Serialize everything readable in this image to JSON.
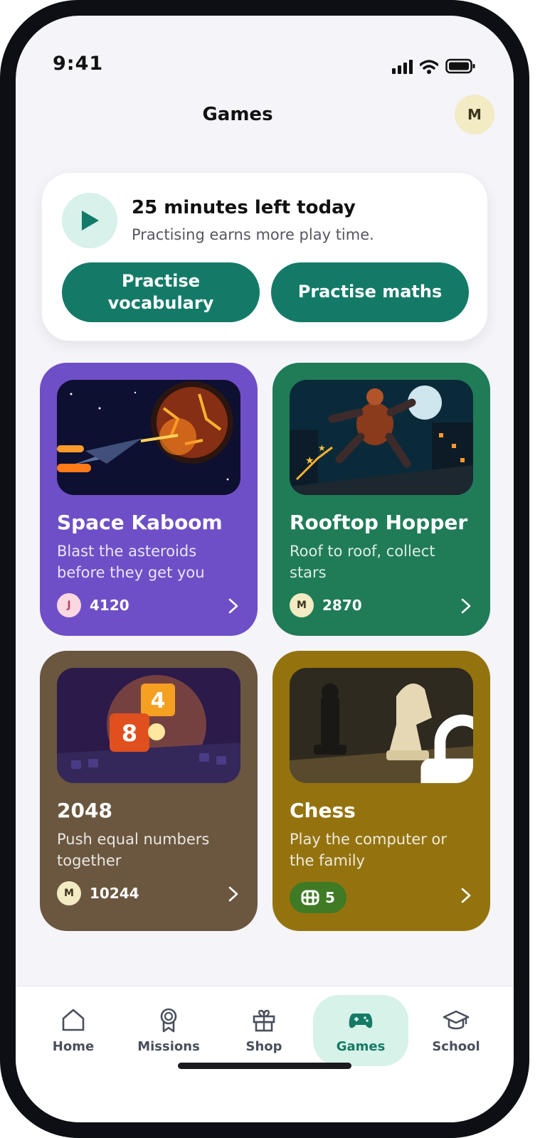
{
  "status_bar": {
    "time": "9:41"
  },
  "header": {
    "title": "Games",
    "avatar_initial": "M"
  },
  "playtime": {
    "title": "25 minutes left today",
    "subtitle": "Practising earns more play time.",
    "buttons": [
      {
        "label": "Practise vocabulary"
      },
      {
        "label": "Practise maths"
      }
    ]
  },
  "games": [
    {
      "title": "Space Kaboom",
      "description": "Blast the asteroids before they get you",
      "player_initial": "J",
      "score": "4120",
      "color": "#6f4fc7",
      "locked": false
    },
    {
      "title": "Rooftop Hopper",
      "description": "Roof to roof, collect stars",
      "player_initial": "M",
      "score": "2870",
      "color": "#1f7c57",
      "locked": false
    },
    {
      "title": "2048",
      "description": "Push equal numbers together",
      "player_initial": "M",
      "score": "10244",
      "color": "#6b573f",
      "locked": false
    },
    {
      "title": "Chess",
      "description": "Play the computer or the family",
      "cost": "5",
      "color": "#94730f",
      "locked": true
    }
  ],
  "nav": {
    "items": [
      {
        "label": "Home",
        "icon": "home-icon"
      },
      {
        "label": "Missions",
        "icon": "award-icon"
      },
      {
        "label": "Shop",
        "icon": "gift-icon"
      },
      {
        "label": "Games",
        "icon": "gamepad-icon",
        "active": true
      },
      {
        "label": "School",
        "icon": "graduation-cap-icon"
      }
    ]
  },
  "colors": {
    "accent": "#147a68",
    "active_nav_bg": "#d7f2e9"
  }
}
